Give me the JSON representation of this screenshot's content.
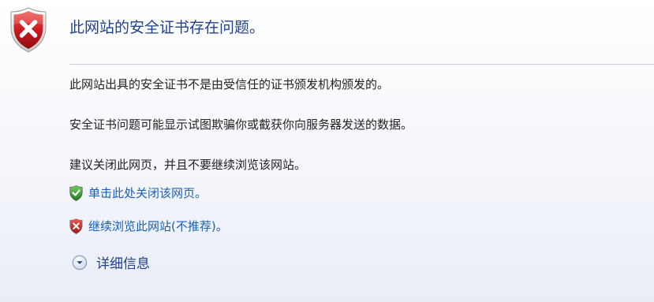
{
  "header": {
    "title": "此网站的安全证书存在问题。",
    "icon": "red-shield-x-icon"
  },
  "messages": [
    "此网站出具的安全证书不是由受信任的证书颁发机构颁发的。",
    "安全证书问题可能显示试图欺骗你或截获你向服务器发送的数据。",
    "建议关闭此网页，并且不要继续浏览该网站。"
  ],
  "actions": {
    "close_page": {
      "label": "单击此处关闭该网页。",
      "icon": "green-shield-check-icon"
    },
    "continue_site": {
      "label": "继续浏览此网站(不推荐)。",
      "icon": "red-shield-x-icon"
    }
  },
  "details": {
    "label": "详细信息",
    "icon": "expand-chevron-down-icon"
  },
  "colors": {
    "title": "#1f3f8f",
    "link": "#1a5fb4",
    "error_red": "#c8161d",
    "ok_green": "#2f8f2f"
  }
}
